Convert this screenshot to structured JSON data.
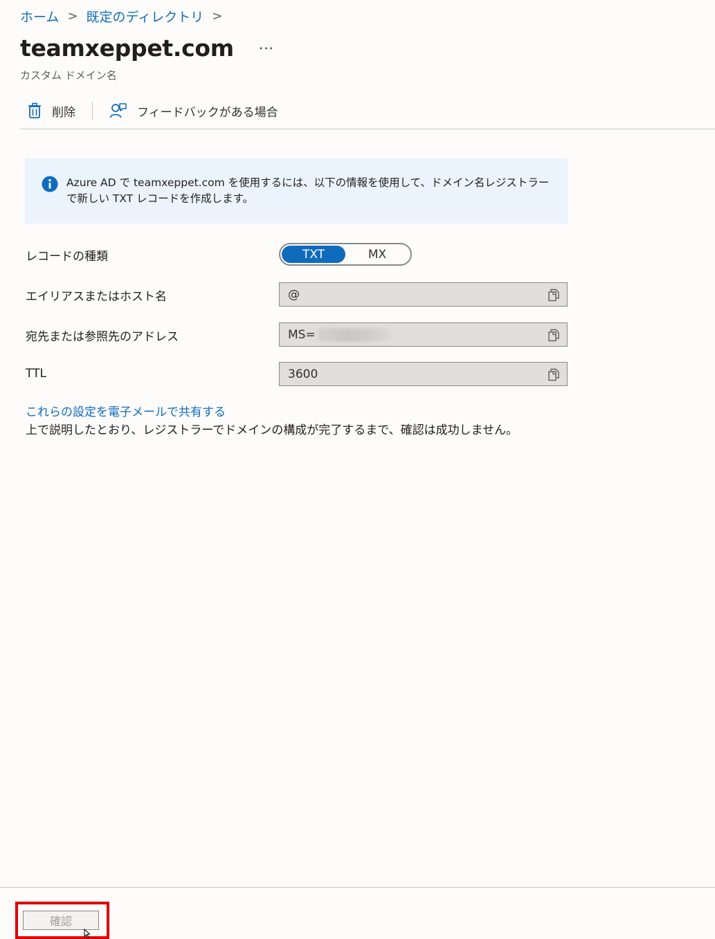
{
  "breadcrumb": {
    "items": [
      "ホーム",
      "既定のディレクトリ"
    ],
    "separator": ">"
  },
  "header": {
    "title": "teamxeppet.com",
    "more_label": "···",
    "subtitle": "カスタム ドメイン名"
  },
  "toolbar": {
    "delete_label": "削除",
    "feedback_label": "フィードバックがある場合"
  },
  "info": {
    "message": "Azure AD で teamxeppet.com を使用するには、以下の情報を使用して、ドメイン名レジストラーで新しい TXT レコードを作成します。"
  },
  "form": {
    "record_type_label": "レコードの種類",
    "record_type_options": [
      "TXT",
      "MX"
    ],
    "record_type_selected": "TXT",
    "alias_label": "エイリアスまたはホスト名",
    "alias_value": "@",
    "destination_label": "宛先または参照先のアドレス",
    "destination_value": "MS=",
    "ttl_label": "TTL",
    "ttl_value": "3600"
  },
  "share_link": "これらの設定を電子メールで共有する",
  "note": "上で説明したとおり、レジストラーでドメインの構成が完了するまで、確認は成功しません。",
  "footer": {
    "verify_label": "確認"
  },
  "colors": {
    "accent": "#0f6cbd",
    "info_bg": "#ebf3fc",
    "highlight": "#e00000"
  }
}
